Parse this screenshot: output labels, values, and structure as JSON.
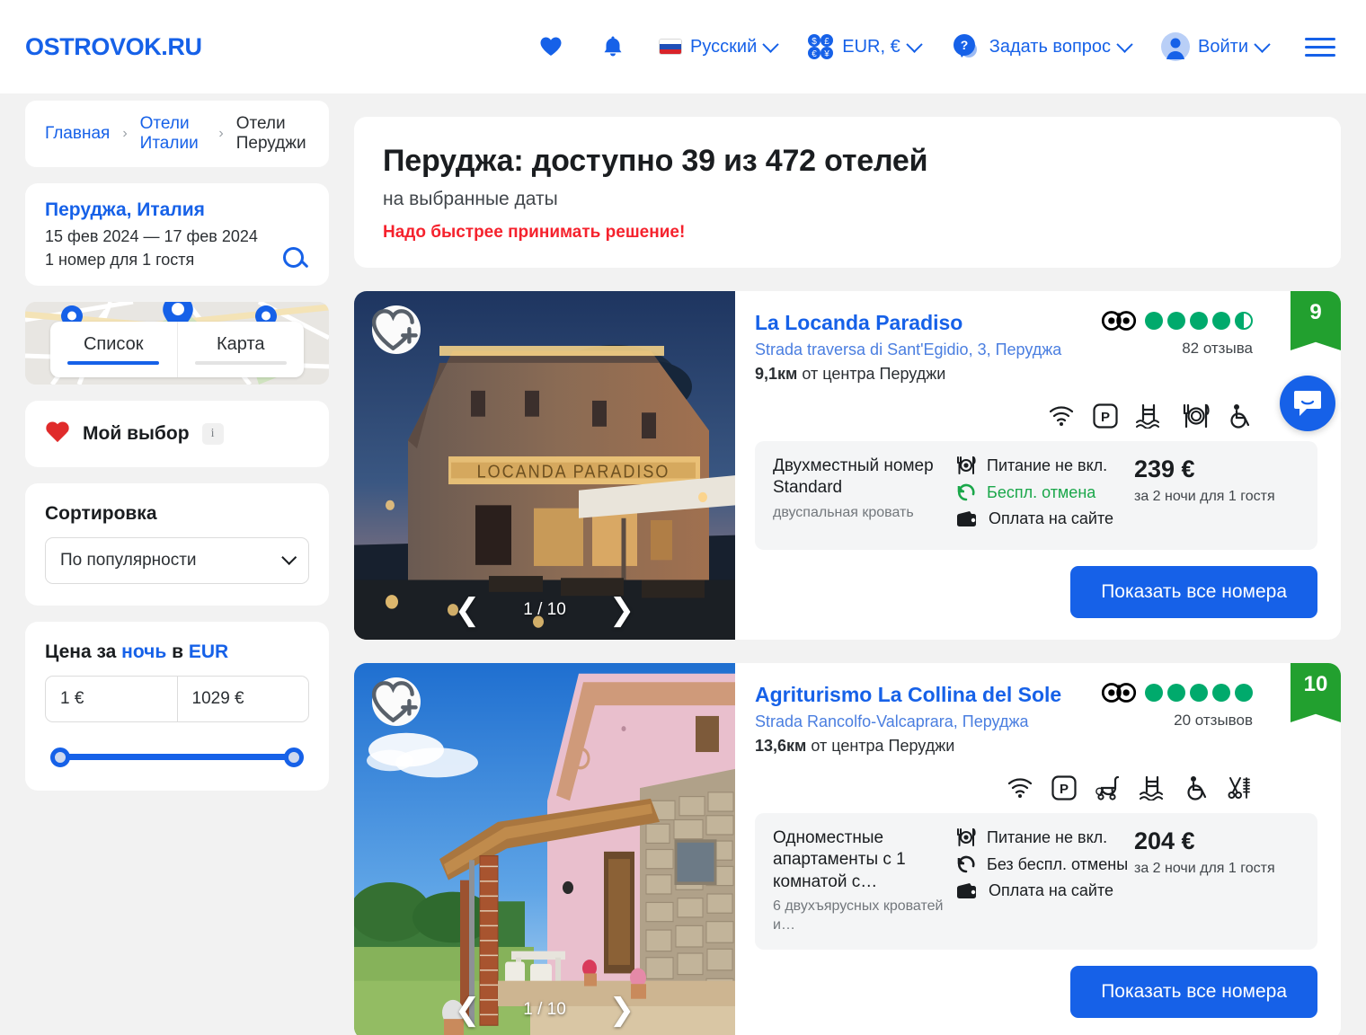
{
  "header": {
    "logo": "OSTROVOK.RU",
    "favorites_icon": "heart-icon",
    "bell_icon": "bell-icon",
    "language": "Русский",
    "currency": "EUR, €",
    "help": "Задать вопрос",
    "login": "Войти",
    "menu_icon": "hamburger-menu-icon",
    "accent_color": "#1661e8"
  },
  "breadcrumb": {
    "items": [
      {
        "label": "Главная",
        "current": false
      },
      {
        "label": "Отели Италии",
        "current": false
      },
      {
        "label": "Отели Перуджи",
        "current": true
      }
    ],
    "separator": "›"
  },
  "sidebar": {
    "search": {
      "city": "Перуджа, Италия",
      "dates": "15 фев 2024 — 17 фев 2024",
      "guests": "1 номер для 1 гостя",
      "search_icon": "magnifier-icon"
    },
    "view_tabs": [
      {
        "label": "Список",
        "active": true
      },
      {
        "label": "Карта",
        "active": false
      }
    ],
    "my_choice": {
      "label": "Мой выбор",
      "info": "i",
      "heart_color": "#e02b2b"
    },
    "sort": {
      "title": "Сортировка",
      "value": "По популярности"
    },
    "price": {
      "title_prefix": "Цена за ",
      "title_link1": "ночь",
      "title_mid": " в ",
      "title_link2": "EUR",
      "min": "1 €",
      "max": "1029 €"
    }
  },
  "main": {
    "title": "Перуджа: доступно 39 из 472 отелей",
    "subtitle": "на выбранные даты",
    "warning": "Надо быстрее принимать решение!",
    "warning_color": "#f5222d"
  },
  "hotels": [
    {
      "name": "La Locanda Paradiso",
      "address": "Strada traversa di Sant'Egidio, 3, Перуджа",
      "distance_value": "9,1км",
      "distance_text": " от центра Перуджи",
      "photo_counter": "1 / 10",
      "prev_icon": "chevron-left-icon",
      "next_icon": "chevron-right-icon",
      "fav_icon": "heart-plus-icon",
      "tripadvisor": {
        "icon": "tripadvisor-owl-icon",
        "bubbles": 4.5,
        "reviews": "82 отзыва"
      },
      "score": "9",
      "score_color": "#22a02f",
      "amenities": [
        "wifi-icon",
        "parking-icon",
        "pool-icon",
        "restaurant-icon",
        "accessible-icon"
      ],
      "room": {
        "title": "Двухместный номер Standard",
        "bed": "двуспальная кровать",
        "features": [
          {
            "icon": "meal-icon",
            "text": "Питание не вкл.",
            "green": false
          },
          {
            "icon": "refund-icon",
            "text": "Беспл. отмена",
            "green": true
          },
          {
            "icon": "wallet-icon",
            "text": "Оплата на сайте",
            "green": false
          }
        ],
        "price": "239 €",
        "price_note": "за 2 ночи для 1 гостя"
      },
      "cta": "Показать все номера"
    },
    {
      "name": "Agriturismo La Collina del Sole",
      "address": "Strada Rancolfo-Valcaprara, Перуджа",
      "distance_value": "13,6км",
      "distance_text": " от центра Перуджи",
      "photo_counter": "1 / 10",
      "prev_icon": "chevron-left-icon",
      "next_icon": "chevron-right-icon",
      "fav_icon": "heart-plus-icon",
      "tripadvisor": {
        "icon": "tripadvisor-owl-icon",
        "bubbles": 5,
        "reviews": "20 отзывов"
      },
      "score": "10",
      "score_color": "#22a02f",
      "amenities": [
        "wifi-icon",
        "parking-icon",
        "stroller-icon",
        "pool-icon",
        "accessible-icon",
        "salon-icon"
      ],
      "room": {
        "title": "Одноместные апартаменты с 1 комнатой с…",
        "bed": "6 двухъярусных кроватей и…",
        "features": [
          {
            "icon": "meal-icon",
            "text": "Питание не вкл.",
            "green": false
          },
          {
            "icon": "refund-icon",
            "text": "Без беспл. отмены",
            "green": false
          },
          {
            "icon": "wallet-icon",
            "text": "Оплата на сайте",
            "green": false
          }
        ],
        "price": "204 €",
        "price_note": "за 2 ночи для 1 гостя"
      },
      "cta": "Показать все номера"
    }
  ],
  "chat_fab": {
    "icon": "chat-bubble-icon"
  }
}
